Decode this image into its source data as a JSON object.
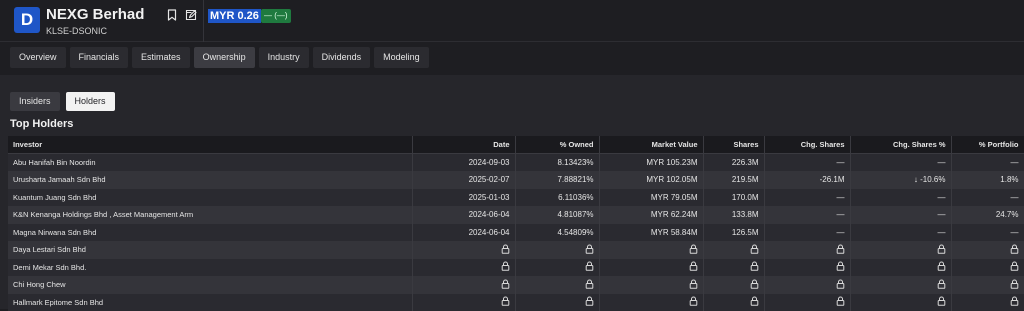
{
  "header": {
    "logo_letter": "D",
    "company_name": "NEXG Berhad",
    "ticker": "KLSE-DSONIC",
    "price": "MYR 0.26",
    "change": "— (—)"
  },
  "tabs": [
    {
      "label": "Overview"
    },
    {
      "label": "Financials"
    },
    {
      "label": "Estimates"
    },
    {
      "label": "Ownership"
    },
    {
      "label": "Industry"
    },
    {
      "label": "Dividends"
    },
    {
      "label": "Modeling"
    }
  ],
  "subtabs": [
    {
      "label": "Insiders"
    },
    {
      "label": "Holders"
    }
  ],
  "section_title": "Top Holders",
  "table": {
    "columns": [
      "Investor",
      "Date",
      "% Owned",
      "Market Value",
      "Shares",
      "Chg. Shares",
      "Chg. Shares %",
      "% Portfolio"
    ],
    "rows": [
      {
        "investor": "Abu Hanifah Bin Noordin",
        "date": "2024-09-03",
        "owned": "8.13423%",
        "market_value": "MYR 105.23M",
        "shares": "226.3M",
        "chg_shares": "—",
        "chg_shares_pct": "—",
        "portfolio": "—"
      },
      {
        "investor": "Urusharta Jamaah Sdn Bhd",
        "date": "2025-02-07",
        "owned": "7.88821%",
        "market_value": "MYR 102.05M",
        "shares": "219.5M",
        "chg_shares": "-26.1M",
        "chg_shares_pct": "↓ -10.6%",
        "portfolio": "1.8%"
      },
      {
        "investor": "Kuantum Juang Sdn Bhd",
        "date": "2025-01-03",
        "owned": "6.11036%",
        "market_value": "MYR 79.05M",
        "shares": "170.0M",
        "chg_shares": "—",
        "chg_shares_pct": "—",
        "portfolio": "—"
      },
      {
        "investor": "K&N Kenanga Holdings Bhd , Asset Management Arm",
        "date": "2024-06-04",
        "owned": "4.81087%",
        "market_value": "MYR 62.24M",
        "shares": "133.8M",
        "chg_shares": "—",
        "chg_shares_pct": "—",
        "portfolio": "24.7%"
      },
      {
        "investor": "Magna Nirwana Sdn Bhd",
        "date": "2024-06-04",
        "owned": "4.54809%",
        "market_value": "MYR 58.84M",
        "shares": "126.5M",
        "chg_shares": "—",
        "chg_shares_pct": "—",
        "portfolio": "—"
      }
    ],
    "locked_rows": [
      {
        "investor": "Daya Lestari Sdn Bhd"
      },
      {
        "investor": "Demi Mekar Sdn Bhd."
      },
      {
        "investor": "Chi Hong Chew"
      },
      {
        "investor": "Hallmark Epitome Sdn Bhd"
      }
    ]
  },
  "colors": {
    "accent": "#1f56c7",
    "positive_bg": "#1f7a3f",
    "negative": "#e5484d"
  },
  "icons": {
    "bookmark": "bookmark-icon",
    "edit": "edit-icon",
    "lock": "lock-icon"
  }
}
